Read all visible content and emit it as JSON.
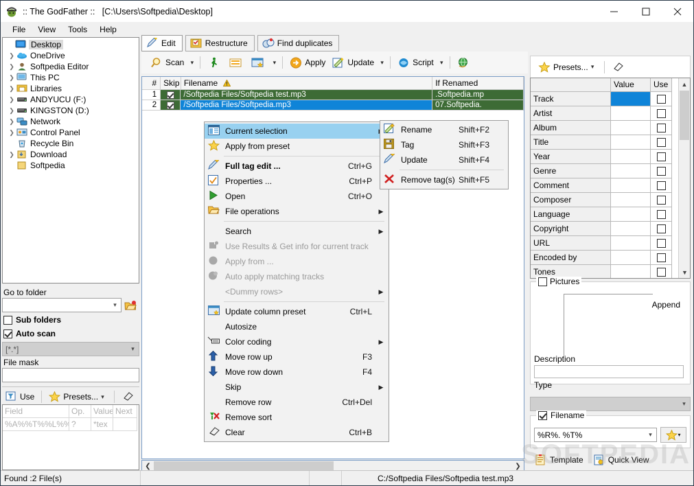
{
  "window": {
    "title": ":: The GodFather ::   [C:\\Users\\Softpedia\\Desktop]",
    "app_icon": "godfather-icon",
    "minimize": "–",
    "maximize": "□",
    "close": "✕"
  },
  "menubar": {
    "items": [
      "File",
      "View",
      "Tools",
      "Help"
    ]
  },
  "tree": {
    "root": {
      "label": "Desktop",
      "icon": "monitor-icon"
    },
    "items": [
      {
        "label": "OneDrive",
        "icon": "cloud-icon",
        "expandable": true
      },
      {
        "label": "Softpedia Editor",
        "icon": "user-icon",
        "expandable": true
      },
      {
        "label": "This PC",
        "icon": "monitor-icon",
        "expandable": true
      },
      {
        "label": "Libraries",
        "icon": "libraries-icon",
        "expandable": true
      },
      {
        "label": "ANDYUCU (F:)",
        "icon": "drive-icon",
        "expandable": true
      },
      {
        "label": "KINGSTON (D:)",
        "icon": "drive-icon",
        "expandable": true
      },
      {
        "label": "Network",
        "icon": "network-icon",
        "expandable": true
      },
      {
        "label": "Control Panel",
        "icon": "control-panel-icon",
        "expandable": true
      },
      {
        "label": "Recycle Bin",
        "icon": "recycle-bin-icon",
        "expandable": false
      },
      {
        "label": "Download",
        "icon": "folder-down-icon",
        "expandable": true
      },
      {
        "label": "Softpedia",
        "icon": "folder-icon",
        "expandable": false
      }
    ]
  },
  "goto": {
    "label": "Go to folder",
    "value": "",
    "placeholder": "",
    "browse_icon": "open-folder-icon",
    "sub_folders_label": "Sub folders",
    "sub_folders_checked": false,
    "auto_scan_label": "Auto scan",
    "auto_scan_checked": true,
    "mask_value": "[*.*]",
    "file_mask_label": "File mask",
    "file_mask_value": ""
  },
  "filterbar": {
    "use_label": "Use",
    "use_icon": "filter-icon",
    "presets_label": "Presets...",
    "presets_icon": "star-icon",
    "clear_icon": "eraser-icon"
  },
  "filtertable": {
    "headers": [
      "Field",
      "Op.",
      "Value",
      "Next"
    ],
    "rows": [
      [
        "%A%%T%%L%%",
        "?",
        "*tex",
        ""
      ]
    ]
  },
  "tabs": [
    {
      "label": "Edit",
      "icon": "brush-icon",
      "active": true
    },
    {
      "label": "Restructure",
      "icon": "folder-check-icon",
      "active": false
    },
    {
      "label": "Find duplicates",
      "icon": "duplicates-icon",
      "active": false
    }
  ],
  "toolbar": [
    {
      "label": "Scan",
      "icon": "magnifier-icon",
      "caret": true
    },
    {
      "label": "",
      "icon": "runner-icon",
      "caret": false
    },
    {
      "label": "",
      "icon": "list-icon",
      "caret": false
    },
    {
      "label": "",
      "icon": "window-star-icon",
      "caret": true
    },
    {
      "label": "Apply",
      "icon": "apply-arrow-icon",
      "caret": false
    },
    {
      "label": "Update",
      "icon": "update-pencil-icon",
      "caret": true
    },
    {
      "label": "Script",
      "icon": "script-icon",
      "caret": true
    },
    {
      "label": "",
      "icon": "globe-icon",
      "caret": false
    }
  ],
  "filelist": {
    "headers": [
      "#",
      "Skip",
      "Filename",
      "If Renamed"
    ],
    "sort_icon": "warning-sort-icon",
    "rows": [
      {
        "num": "1",
        "skip": true,
        "filename": "/Softpedia Files/Softpedia test.mp3",
        "if_renamed": ".Softpedia.mp",
        "selected": false
      },
      {
        "num": "2",
        "skip": true,
        "filename": "/Softpedia Files/Softpedia.mp3",
        "if_renamed": "07.Softpedia.",
        "selected": true
      }
    ]
  },
  "context_menu": {
    "items": [
      {
        "label": "Current selection",
        "key": "",
        "icon": "columns-icon",
        "submenu": true,
        "highlight": true,
        "disabled": false,
        "bold": false
      },
      {
        "label": "Apply from preset",
        "key": "",
        "icon": "star-icon",
        "submenu": false,
        "highlight": false,
        "disabled": false,
        "bold": false
      },
      {
        "sep": true
      },
      {
        "label": "Full tag edit ...",
        "key": "Ctrl+G",
        "icon": "brush-icon",
        "submenu": false,
        "highlight": false,
        "disabled": false,
        "bold": true
      },
      {
        "label": "Properties ...",
        "key": "Ctrl+P",
        "icon": "properties-icon",
        "submenu": false,
        "highlight": false,
        "disabled": false,
        "bold": false
      },
      {
        "label": "Open",
        "key": "Ctrl+O",
        "icon": "play-icon",
        "submenu": false,
        "highlight": false,
        "disabled": false,
        "bold": false
      },
      {
        "label": "File operations",
        "key": "",
        "icon": "open-folder-icon",
        "submenu": true,
        "highlight": false,
        "disabled": false,
        "bold": false
      },
      {
        "sep": true
      },
      {
        "label": "Search",
        "key": "",
        "icon": "",
        "submenu": true,
        "highlight": false,
        "disabled": false,
        "bold": false
      },
      {
        "label": "Use Results & Get info for current track",
        "key": "",
        "icon": "gray-shape-icon",
        "submenu": false,
        "highlight": false,
        "disabled": true,
        "bold": false
      },
      {
        "label": "Apply from ...",
        "key": "",
        "icon": "gray-circle-icon",
        "submenu": false,
        "highlight": false,
        "disabled": true,
        "bold": false
      },
      {
        "label": "Auto apply matching tracks",
        "key": "",
        "icon": "gray-blob-icon",
        "submenu": false,
        "highlight": false,
        "disabled": true,
        "bold": false
      },
      {
        "label": "<Dummy rows>",
        "key": "",
        "icon": "",
        "submenu": true,
        "highlight": false,
        "disabled": true,
        "bold": false
      },
      {
        "sep": true
      },
      {
        "label": "Update column preset",
        "key": "Ctrl+L",
        "icon": "window-star-icon",
        "submenu": false,
        "highlight": false,
        "disabled": false,
        "bold": false
      },
      {
        "label": "Autosize",
        "key": "",
        "icon": "",
        "submenu": false,
        "highlight": false,
        "disabled": false,
        "bold": false
      },
      {
        "label": "Color coding",
        "key": "",
        "icon": "color-coding-icon",
        "submenu": true,
        "highlight": false,
        "disabled": false,
        "bold": false
      },
      {
        "label": "Move row up",
        "key": "F3",
        "icon": "arrow-up-icon",
        "submenu": false,
        "highlight": false,
        "disabled": false,
        "bold": false
      },
      {
        "label": "Move row down",
        "key": "F4",
        "icon": "arrow-down-icon",
        "submenu": false,
        "highlight": false,
        "disabled": false,
        "bold": false
      },
      {
        "label": "Skip",
        "key": "",
        "icon": "",
        "submenu": true,
        "highlight": false,
        "disabled": false,
        "bold": false
      },
      {
        "label": "Remove row",
        "key": "Ctrl+Del",
        "icon": "",
        "submenu": false,
        "highlight": false,
        "disabled": false,
        "bold": false
      },
      {
        "label": "Remove sort",
        "key": "",
        "icon": "remove-sort-icon",
        "submenu": false,
        "highlight": false,
        "disabled": false,
        "bold": false
      },
      {
        "label": "Clear",
        "key": "Ctrl+B",
        "icon": "eraser-icon",
        "submenu": false,
        "highlight": false,
        "disabled": false,
        "bold": false
      }
    ]
  },
  "submenu": {
    "items": [
      {
        "label": "Rename",
        "key": "Shift+F2",
        "icon": "rename-icon"
      },
      {
        "label": "Tag",
        "key": "Shift+F3",
        "icon": "save-icon"
      },
      {
        "label": "Update",
        "key": "Shift+F4",
        "icon": "brush-icon"
      },
      {
        "sep": true
      },
      {
        "label": "Remove tag(s)",
        "key": "Shift+F5",
        "icon": "red-x-icon"
      }
    ]
  },
  "right_panel": {
    "presets_label": "Presets...",
    "presets_icon": "star-icon",
    "clear_icon": "eraser-icon",
    "table": {
      "headers": [
        "",
        "Value",
        "Use"
      ],
      "rows": [
        {
          "field": "Track",
          "value": "",
          "use": false,
          "selected": true
        },
        {
          "field": "Artist",
          "value": "",
          "use": false,
          "selected": false
        },
        {
          "field": "Album",
          "value": "",
          "use": false,
          "selected": false
        },
        {
          "field": "Title",
          "value": "",
          "use": false,
          "selected": false
        },
        {
          "field": "Year",
          "value": "",
          "use": false,
          "selected": false
        },
        {
          "field": "Genre",
          "value": "",
          "use": false,
          "selected": false
        },
        {
          "field": "Comment",
          "value": "",
          "use": false,
          "selected": false
        },
        {
          "field": "Composer",
          "value": "",
          "use": false,
          "selected": false
        },
        {
          "field": "Language",
          "value": "",
          "use": false,
          "selected": false
        },
        {
          "field": "Copyright",
          "value": "",
          "use": false,
          "selected": false
        },
        {
          "field": "URL",
          "value": "",
          "use": false,
          "selected": false
        },
        {
          "field": "Encoded by",
          "value": "",
          "use": false,
          "selected": false
        },
        {
          "field": "Tones",
          "value": "",
          "use": false,
          "selected": false
        }
      ]
    },
    "pictures": {
      "label": "Pictures",
      "checked": false,
      "append_label": "Append",
      "description_label": "Description",
      "description_value": "",
      "type_label": "Type",
      "type_value": ""
    },
    "filename": {
      "label": "Filename",
      "checked": true,
      "value": "%R%. %T%",
      "presets_icon": "star-icon"
    },
    "bottom_tabs": [
      {
        "label": "Template",
        "icon": "template-icon",
        "active": true
      },
      {
        "label": "Quick View",
        "icon": "quickview-icon",
        "active": false
      }
    ]
  },
  "statusbar": {
    "found": "Found :2 File(s)",
    "path": "C:/Softpedia Files/Softpedia test.mp3"
  },
  "watermark": "SOFTPEDIA",
  "colors": {
    "row_green": "#3d6b35",
    "selection_blue": "#0f84d8",
    "menu_highlight": "#98d1f0",
    "chrome": "#f0f0f0"
  }
}
